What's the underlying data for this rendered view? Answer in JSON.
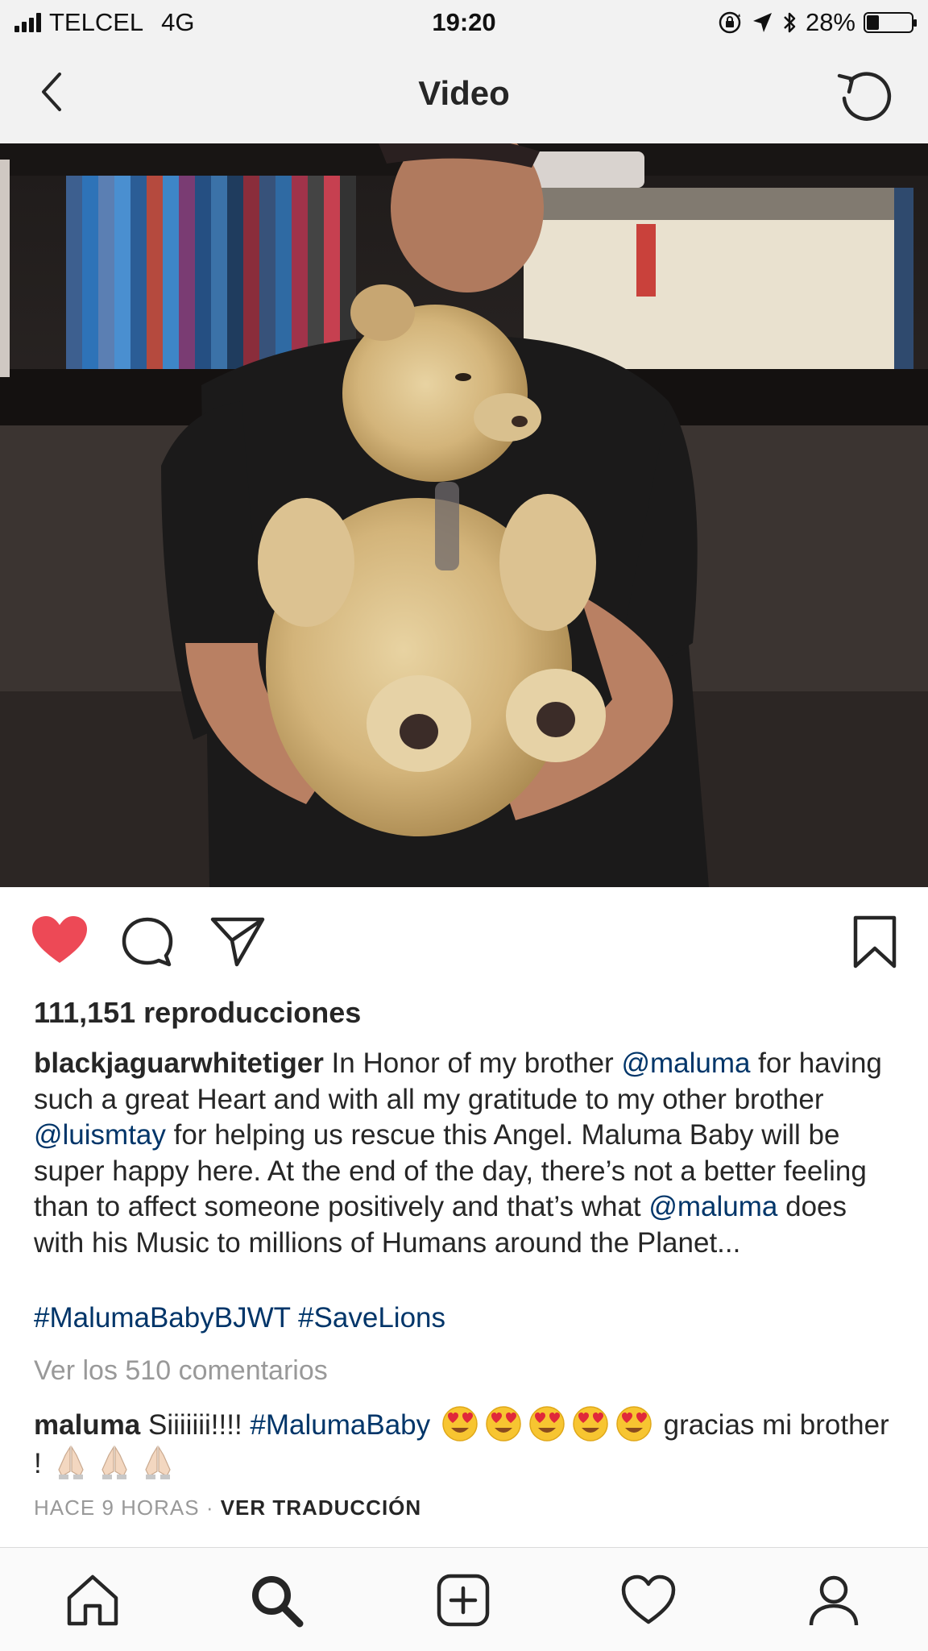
{
  "status_bar": {
    "carrier": "TELCEL",
    "network": "4G",
    "time": "19:20",
    "battery_percent": "28%",
    "battery_level": 0.28,
    "icons": [
      "signal-icon",
      "orientation-lock-icon",
      "location-icon",
      "bluetooth-icon",
      "battery-icon"
    ]
  },
  "nav": {
    "title": "Video",
    "back_icon": "chevron-left-icon",
    "replay_icon": "replay-icon"
  },
  "actions": {
    "like_icon": "heart-filled-icon",
    "comment_icon": "comment-icon",
    "share_icon": "share-icon",
    "save_icon": "bookmark-icon",
    "like_color": "#ed4956"
  },
  "post": {
    "views": "111,151 reproducciones",
    "caption_user": "blackjaguarwhitetiger",
    "caption_part1": " In Honor of my brother ",
    "mention1": "@maluma",
    "caption_part2": " for having such a great Heart and with all my gratitude to my other brother ",
    "mention2": "@luismtay",
    "caption_part3": " for helping us rescue this Angel. Maluma Baby will be super happy here. At the end of the day, there’s not a better feeling than to affect someone positively and that’s what ",
    "mention3": "@maluma",
    "caption_part4": " does with his Music to millions of Humans around the Planet...",
    "hashtag1": "#MalumaBabyBJWT",
    "hashtag2": "#SaveLions",
    "view_comments": "Ver los 510 comentarios",
    "link_color": "#003569"
  },
  "comment": {
    "user": "maluma",
    "text_part1": " Siiiiiii!!!! ",
    "hashtag": "#MalumaBaby",
    "text_part2": " gracias mi brother ! ",
    "emojis_after_hashtag": [
      "heart-eyes-emoji",
      "heart-eyes-emoji",
      "heart-eyes-emoji",
      "heart-eyes-emoji",
      "heart-eyes-emoji"
    ],
    "emojis_end": [
      "folded-hands-emoji",
      "folded-hands-emoji",
      "folded-hands-emoji"
    ]
  },
  "meta": {
    "time_ago": "HACE 9 HORAS",
    "separator": " · ",
    "translate": "VER TRADUCCIÓN"
  },
  "tab_bar": {
    "items": [
      "home-icon",
      "search-icon",
      "new-post-icon",
      "activity-icon",
      "profile-icon"
    ],
    "active": "search-icon"
  }
}
